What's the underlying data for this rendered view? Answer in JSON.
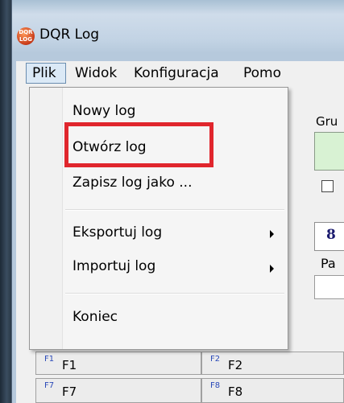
{
  "window": {
    "title": "DQR Log",
    "icon_text": "DQR\nLOG"
  },
  "menubar": {
    "items": [
      {
        "label": "Plik"
      },
      {
        "label": "Widok"
      },
      {
        "label": "Konfiguracja"
      },
      {
        "label": "Pomo"
      }
    ]
  },
  "file_menu": {
    "items": [
      {
        "label": "Nowy log"
      },
      {
        "label": "Otwórz log"
      },
      {
        "label": "Zapisz log jako ..."
      },
      {
        "label": "Eksportuj log"
      },
      {
        "label": "Importuj log"
      },
      {
        "label": "Koniec"
      }
    ],
    "highlight_color": "#e0262d"
  },
  "right_panel": {
    "group_label": "Gru",
    "bold_field_text": "8",
    "pa_label": "Pa"
  },
  "function_keys": [
    {
      "num": "F1",
      "label": "F1"
    },
    {
      "num": "F2",
      "label": "F2"
    },
    {
      "num": "F7",
      "label": "F7"
    },
    {
      "num": "F8",
      "label": "F8"
    }
  ]
}
